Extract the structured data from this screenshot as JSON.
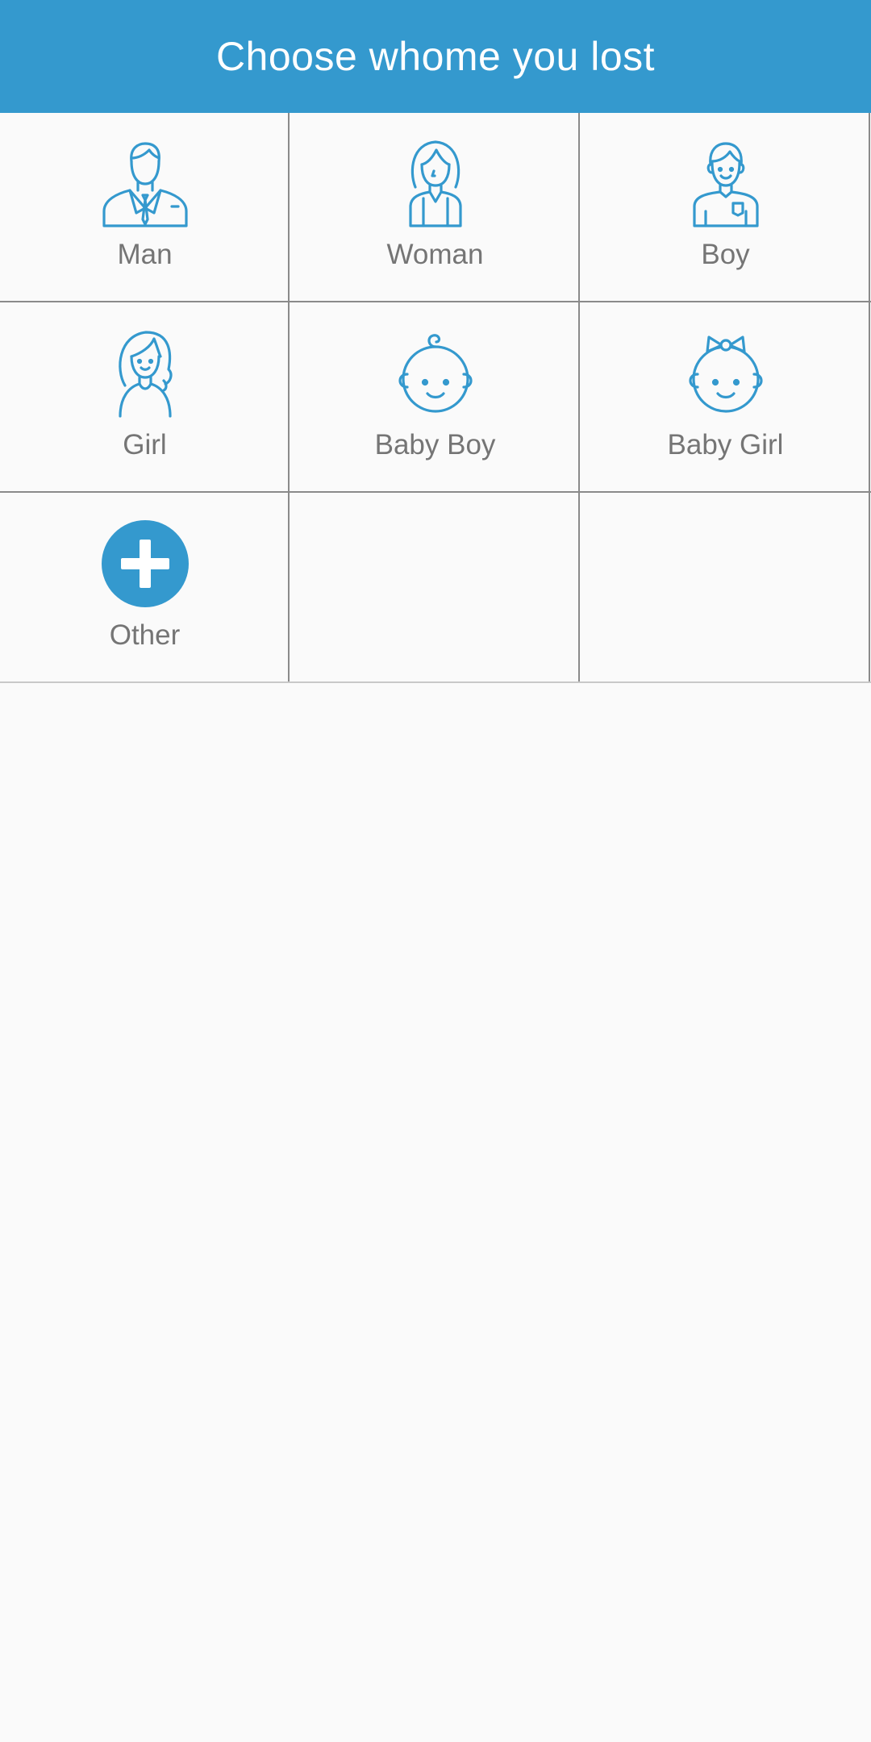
{
  "header": {
    "title": "Choose whome you lost"
  },
  "colors": {
    "primary": "#3499ce",
    "label": "#757575",
    "divider": "#8a8a8a",
    "background": "#fafafa"
  },
  "options": [
    {
      "label": "Man",
      "icon": "man-icon"
    },
    {
      "label": "Woman",
      "icon": "woman-icon"
    },
    {
      "label": "Boy",
      "icon": "boy-icon"
    },
    {
      "label": "Girl",
      "icon": "girl-icon"
    },
    {
      "label": "Baby Boy",
      "icon": "baby-boy-icon"
    },
    {
      "label": "Baby Girl",
      "icon": "baby-girl-icon"
    },
    {
      "label": "Other",
      "icon": "add-circle-icon"
    }
  ]
}
